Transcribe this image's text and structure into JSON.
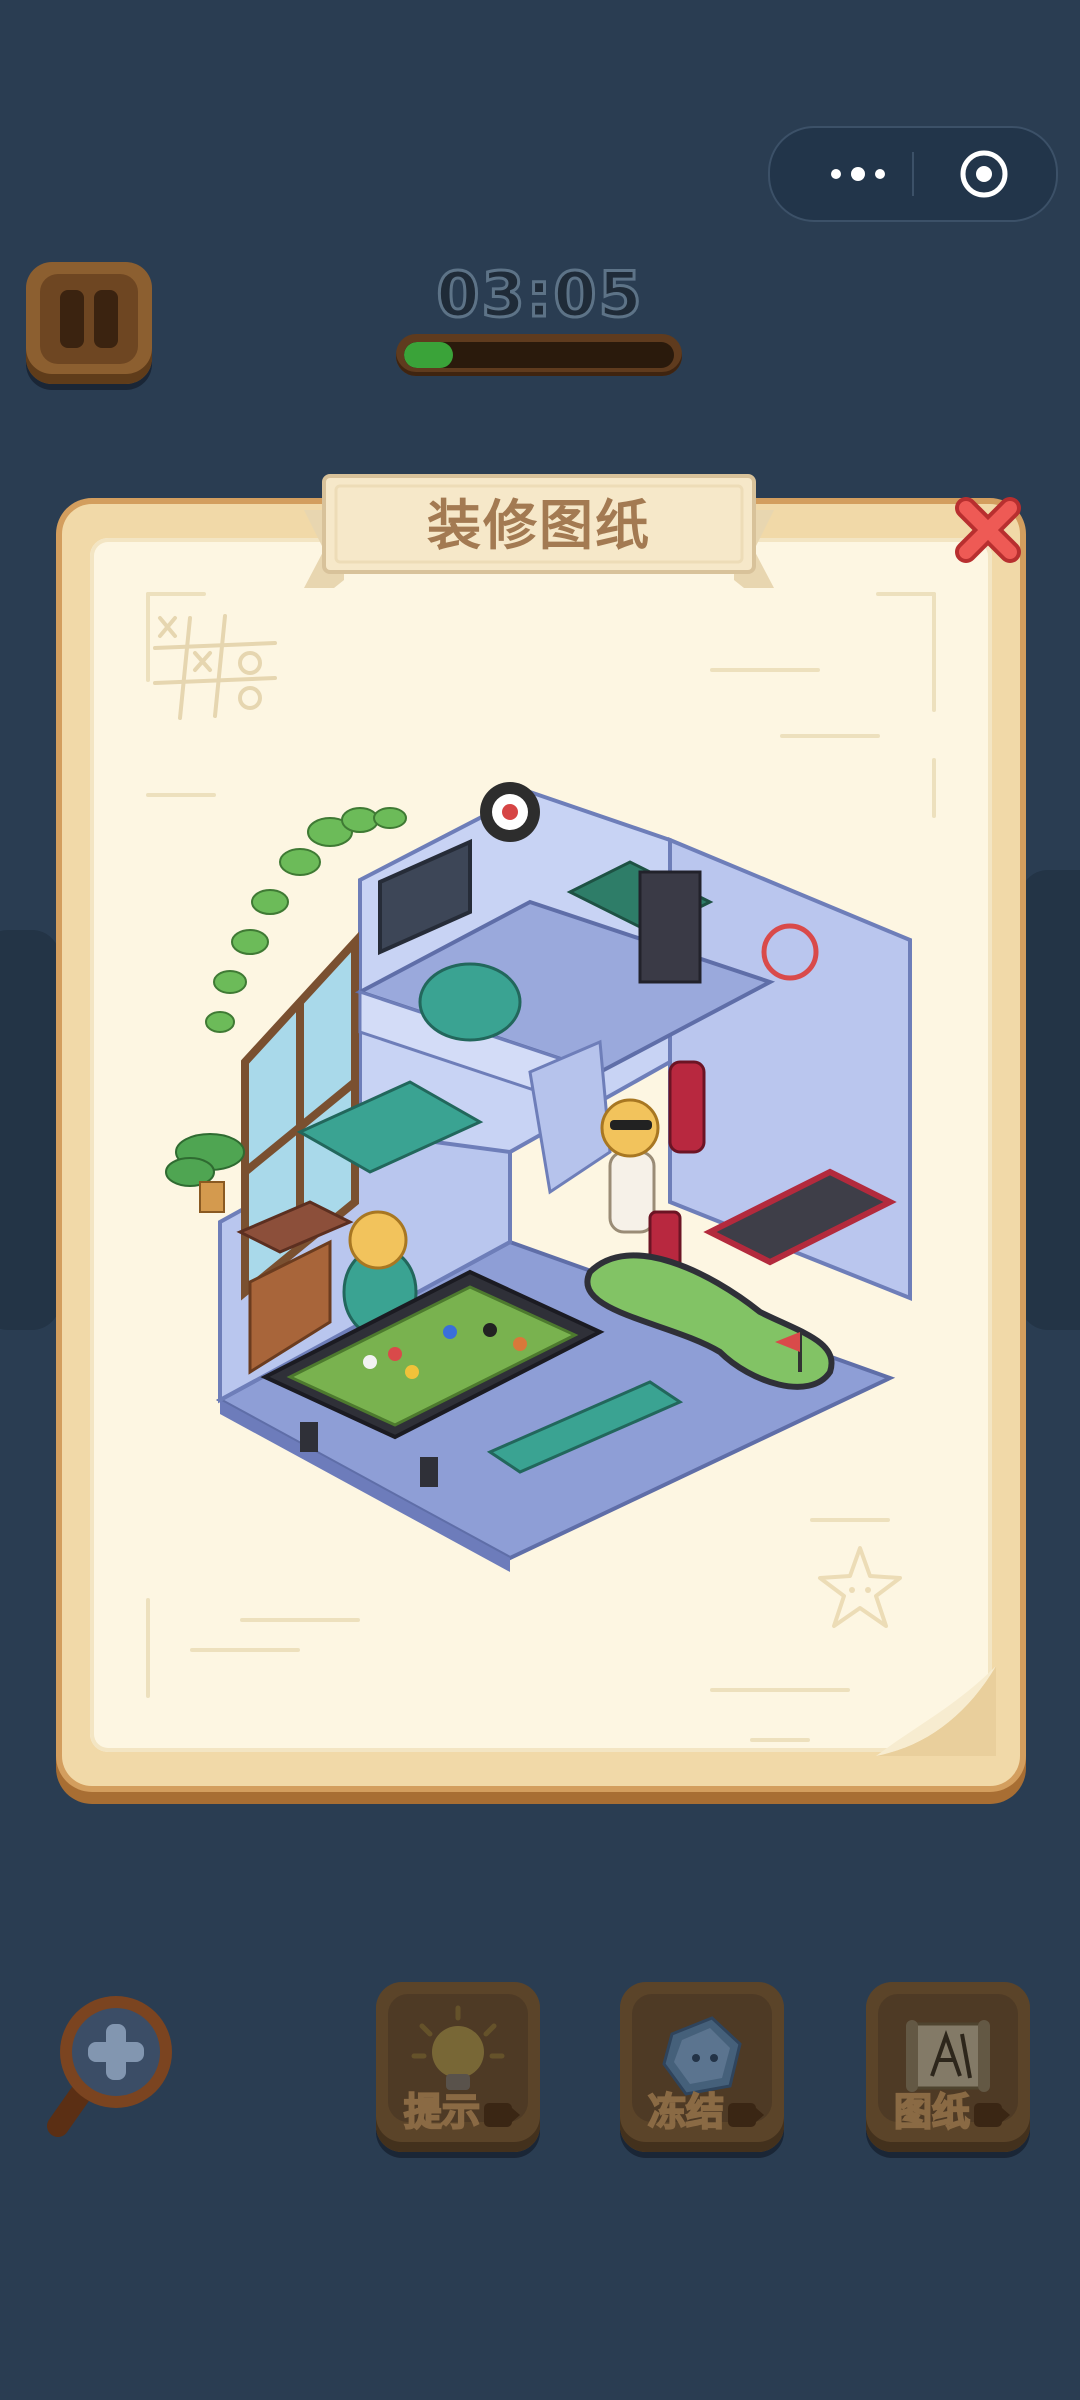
{
  "header": {
    "timer": "03:05",
    "progress_fraction": 0.18
  },
  "modal": {
    "title": "装修图纸"
  },
  "tools": [
    {
      "label": "提示",
      "icon": "lightbulb-icon"
    },
    {
      "label": "冻结",
      "icon": "ice-cube-icon"
    },
    {
      "label": "图纸",
      "icon": "blueprint-scroll-icon"
    }
  ],
  "icons": {
    "menu": "more-dots-icon",
    "close_app": "target-circle-icon",
    "pause": "pause-icon",
    "close_modal": "close-x-icon",
    "zoom": "magnifier-plus-icon"
  },
  "colors": {
    "background": "#2a3d52",
    "paper": "#fdf6e2",
    "frame": "#d39e5e",
    "close_red": "#e84a4a",
    "progress_green": "#3aa339"
  }
}
